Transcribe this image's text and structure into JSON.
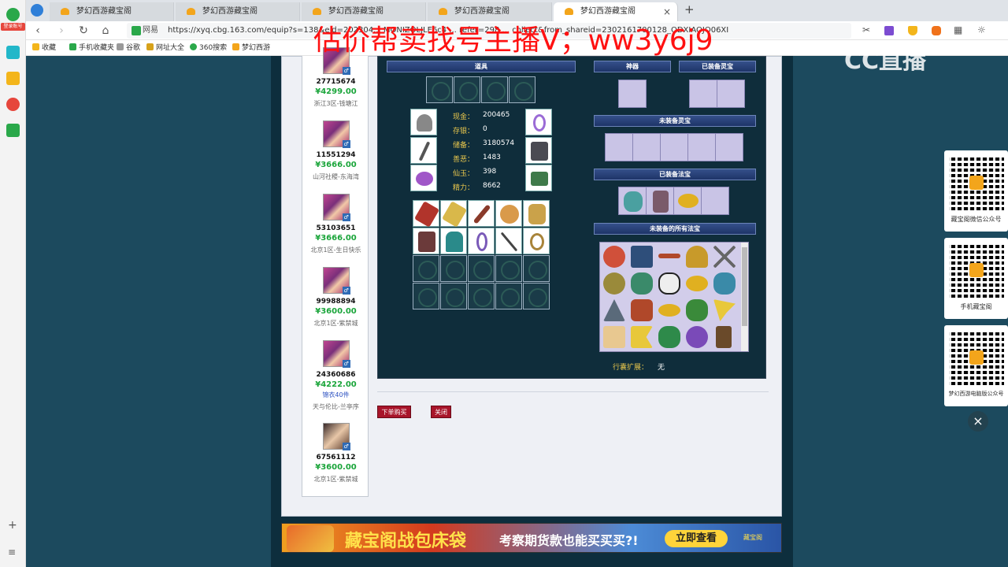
{
  "browser": {
    "tabs": [
      {
        "label": "梦幻西游藏宝阁"
      },
      {
        "label": "梦幻西游藏宝阁"
      },
      {
        "label": "梦幻西游藏宝阁"
      },
      {
        "label": "梦幻西游藏宝阁"
      },
      {
        "label": "梦幻西游藏宝阁"
      }
    ],
    "new_tab": "+",
    "site_name": "网易",
    "url": "https://xyq.cbg.163.com/equip?s=138&eid=202304... MONIZOLJLE6c4 ... refer=298 ... collect&from_shareid=2302161700128_ODXIAOJO06XI",
    "bookmarks": [
      "收藏",
      "手机收藏夹",
      "谷歌",
      "网址大全",
      "360搜索",
      "梦幻西游"
    ],
    "sidebar_badge": "登录账号"
  },
  "overlay_text": "估价帮卖找号主播V；ww3y6j9",
  "watermark": "CC直播",
  "sellers": [
    {
      "id": "27715674",
      "price": "¥4299.00",
      "extra": "",
      "server": "浙江3区-钱塘江"
    },
    {
      "id": "11551294",
      "price": "¥3666.00",
      "extra": "",
      "server": "山河社稷-东海湾"
    },
    {
      "id": "53103651",
      "price": "¥3666.00",
      "extra": "",
      "server": "北京1区-生日快乐"
    },
    {
      "id": "99988894",
      "price": "¥3600.00",
      "extra": "",
      "server": "北京1区-紫禁城"
    },
    {
      "id": "24360686",
      "price": "¥4222.00",
      "extra": "锦衣40件",
      "server": "天与伦比-兰亭序"
    },
    {
      "id": "67561112",
      "price": "¥3600.00",
      "extra": "",
      "server": "北京1区-紫禁城"
    }
  ],
  "headers": {
    "props": "道具",
    "artifact": "神器",
    "equipped_lingbao": "已装备灵宝",
    "unequipped_lingbao": "未装备灵宝",
    "equipped_fabao": "已装备法宝",
    "all_unequipped_fabao": "未装备的所有法宝"
  },
  "stats": [
    {
      "label": "现金：",
      "value": "200465"
    },
    {
      "label": "存银：",
      "value": "0"
    },
    {
      "label": "储备：",
      "value": "3180574"
    },
    {
      "label": "善恶：",
      "value": "1483"
    },
    {
      "label": "仙玉：",
      "value": "398"
    },
    {
      "label": "精力：",
      "value": "8662"
    }
  ],
  "bag_expand": {
    "label": "行囊扩展：",
    "value": "无"
  },
  "buttons": {
    "buy": "下单购买",
    "close": "关闭"
  },
  "banner": {
    "title": "藏宝阁战包床袋",
    "subtitle": "考察期货款也能买买买?!",
    "cta": "立即查看",
    "logo": "藏宝阁"
  },
  "qr_cards": [
    {
      "caption": "藏宝阁微信公众号"
    },
    {
      "caption": "手机藏宝阁"
    },
    {
      "caption": "梦幻西游电脑版公众号"
    }
  ],
  "colors": {
    "accent_red": "#a8152a",
    "price_green": "#1aa53a",
    "stat_gold": "#e8c64c",
    "header_blue": "#2a4278"
  }
}
